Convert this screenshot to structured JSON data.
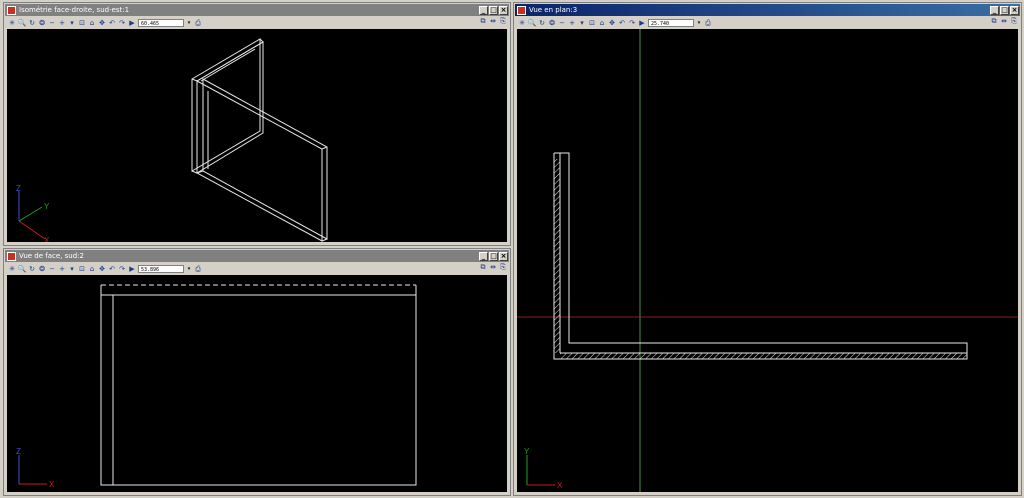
{
  "windows": {
    "iso": {
      "title": "Isométrie face-droite, sud-est:1",
      "zoom": "60.465"
    },
    "front": {
      "title": "Vue de face, sud:2",
      "zoom": "53.896"
    },
    "plan": {
      "title": "Vue en plan:3",
      "zoom": "25.740"
    }
  },
  "window_buttons": {
    "minimize": "_",
    "maximize": "□",
    "close": "×"
  },
  "toolbar_icons": {
    "hand": "✳",
    "zoom": "🔍",
    "rotate": "↻",
    "orbit": "❂",
    "minus": "−",
    "plus": "+",
    "arrow": "▾",
    "window_zoom": "⊡",
    "house": "⌂",
    "pan": "✥",
    "prev": "↶",
    "next": "↷",
    "folder": "▶",
    "print": "⎙",
    "tile": "⧉",
    "split": "⇹",
    "copy": "⎘"
  },
  "axes": {
    "iso": {
      "z": "Z",
      "y": "Y",
      "x": "X"
    },
    "front": {
      "z": "Z",
      "x": "X"
    },
    "plan": {
      "y": "Y",
      "x": "X"
    }
  },
  "colors": {
    "viewport_bg": "#000000",
    "active_title": "#0a246a",
    "inactive_title": "#808080",
    "axis_x": "#c81e1e",
    "axis_y": "#1ea01e",
    "axis_z": "#3c50c8"
  }
}
